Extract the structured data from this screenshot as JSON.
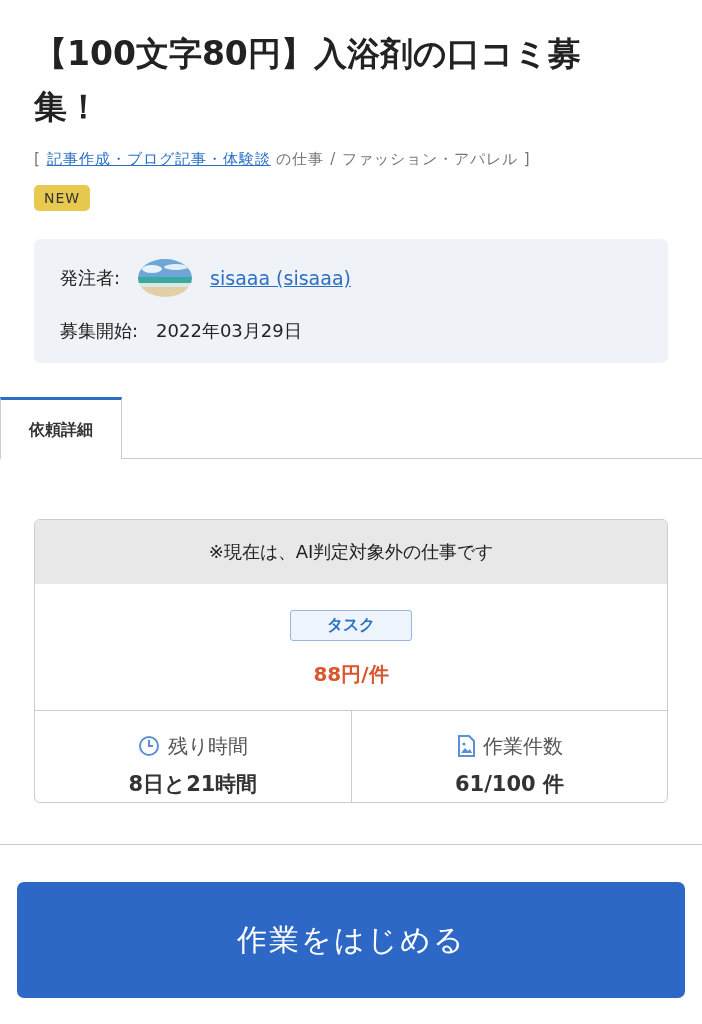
{
  "title": "【100文字80円】入浴剤の口コミ募集！",
  "breadcrumb": {
    "prefix": "[",
    "link": "記事作成・ブログ記事・体験談",
    "suffix": "の仕事 / ファッション・アパレル ]"
  },
  "badge": "NEW",
  "info": {
    "client_label": "発注者:",
    "client_name": "sisaaa (sisaaa)",
    "start_label": "募集開始:",
    "start_date": "2022年03月29日"
  },
  "tabs": [
    {
      "label": "依頼詳細",
      "selected": true
    }
  ],
  "card": {
    "notice": "※現在は、AI判定対象外の仕事です",
    "type": "タスク",
    "price": "88円/件",
    "stats": [
      {
        "kind": "clock",
        "label": "残り時間",
        "value": "8日と21時間"
      },
      {
        "kind": "document",
        "label": "作業件数",
        "value": "61/100 件"
      }
    ]
  },
  "action": "作業をはじめる"
}
